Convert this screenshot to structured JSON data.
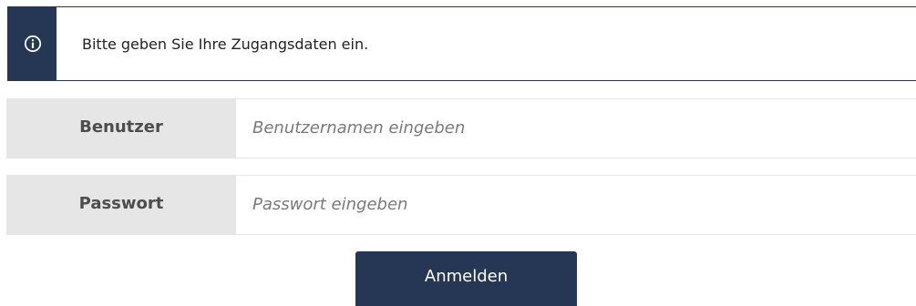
{
  "info": {
    "icon": "info-circle-icon",
    "message": "Bitte geben Sie Ihre Zugangsdaten ein."
  },
  "form": {
    "user": {
      "label": "Benutzer",
      "value": "",
      "placeholder": "Benutzernamen eingeben"
    },
    "password": {
      "label": "Passwort",
      "value": "",
      "placeholder": "Passwort eingeben"
    },
    "submit_label": "Anmelden"
  },
  "colors": {
    "primary": "#253755",
    "label_background": "#e6e6e6",
    "label_text": "#4d4d4d",
    "button_text": "#ffffff"
  }
}
